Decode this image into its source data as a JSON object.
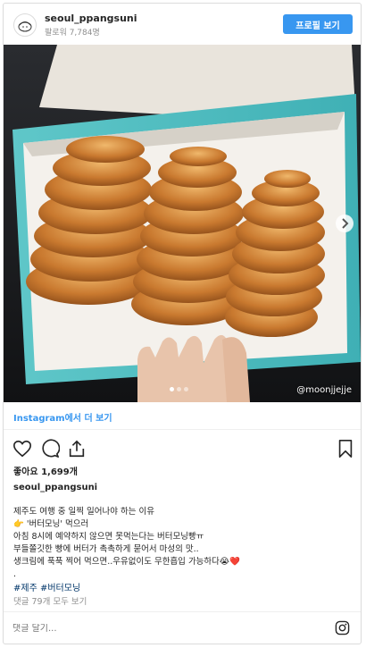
{
  "header": {
    "username": "seoul_ppangsuni",
    "followers": "팔로워 7,784명",
    "profile_button": "프로필 보기"
  },
  "photo": {
    "watermark": "@moonjjejje",
    "carousel_count": 3,
    "carousel_active": 1
  },
  "more_link": "Instagram에서 더 보기",
  "likes": "좋아요 1,699개",
  "caption": {
    "author": "seoul_ppangsuni",
    "lines": [
      "제주도 여행 중 일찍 일어나야 하는 이유",
      "👉 '버터모닝' 먹으러",
      "아침 8시에 예약하지 않으면 못먹는다는 버터모닝빵ㅠ",
      "부들쫄깃한 빵에 버터가 촉촉하게 묻어서 마성의 맛..",
      "생크림에 푹푹 찍어 먹으면..우유없이도 무한흡입 가능하다😭❤️",
      "."
    ]
  },
  "hashtags": "#제주 #버터모닝",
  "comments_link": "댓글 79개 모두 보기",
  "comment_placeholder": "댓글 달기...",
  "icons": [
    "heart-icon",
    "comment-icon",
    "share-icon",
    "bookmark-icon",
    "instagram-logo-icon",
    "chevron-right-icon"
  ],
  "colors": {
    "accent": "#3897f0",
    "hashtag": "#003569",
    "muted": "#8e8e8e"
  }
}
